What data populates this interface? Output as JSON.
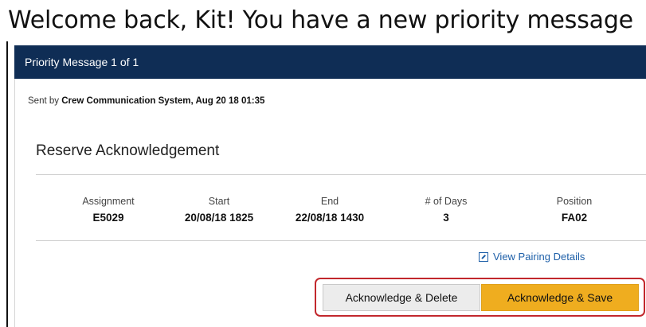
{
  "welcome": {
    "text": "Welcome back, Kit! You have a new priority message"
  },
  "header": {
    "title": "Priority Message 1 of 1"
  },
  "message": {
    "sent_prefix": "Sent by ",
    "sender": "Crew Communication System, Aug 20 18 01:35",
    "title": "Reserve Acknowledgement",
    "columns": [
      {
        "label": "Assignment",
        "value": "E5029"
      },
      {
        "label": "Start",
        "value": "20/08/18 1825"
      },
      {
        "label": "End",
        "value": "22/08/18 1430"
      },
      {
        "label": "# of Days",
        "value": "3"
      },
      {
        "label": "Position",
        "value": "FA02"
      }
    ],
    "pairing_link": "View Pairing Details"
  },
  "actions": {
    "delete_label": "Acknowledge & Delete",
    "save_label": "Acknowledge & Save"
  },
  "colors": {
    "header_bg": "#0f2d55",
    "save_button": "#efad1f",
    "highlight_border": "#c2282d",
    "link": "#1d5fa8"
  },
  "icons": {
    "pairing_link": "external-link-icon"
  }
}
